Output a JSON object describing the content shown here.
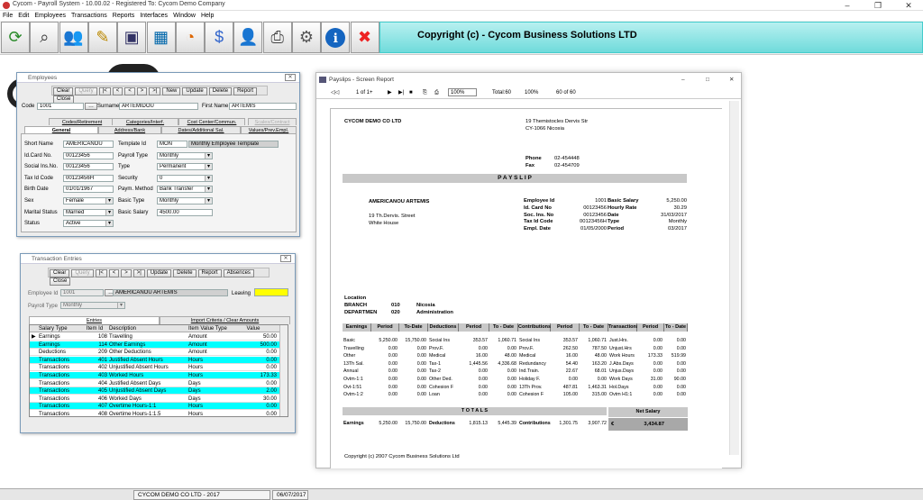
{
  "app": {
    "title": "Cycom - Payroll System - 10.00.02 - Registered To: Cycom Demo Company",
    "menu": [
      "File",
      "Edit",
      "Employees",
      "Transactions",
      "Reports",
      "Interfaces",
      "Window",
      "Help"
    ],
    "copyright": "Copyright (c) - Cycom Business Solutions LTD",
    "status": {
      "company": "CYCOM DEMO CO LTD - 2017",
      "date": "06/07/2017"
    }
  },
  "toolbar": [
    {
      "name": "refresh-icon",
      "glyph": "⟳",
      "color": "#2a8a2a"
    },
    {
      "name": "binoculars-icon",
      "glyph": "⌕",
      "color": "#333"
    },
    {
      "name": "employees-icon",
      "glyph": "👥",
      "color": "#4a7"
    },
    {
      "name": "edit-icon",
      "glyph": "✎",
      "color": "#b80"
    },
    {
      "name": "monitor-icon",
      "glyph": "▣",
      "color": "#336"
    },
    {
      "name": "spreadsheet-icon",
      "glyph": "▦",
      "color": "#06a"
    },
    {
      "name": "pie-chart-icon",
      "glyph": "◔",
      "color": "#d60"
    },
    {
      "name": "dollar-icon",
      "glyph": "$",
      "color": "#36c"
    },
    {
      "name": "user-icon",
      "glyph": "👤",
      "color": "#36c"
    },
    {
      "name": "printer-icon",
      "glyph": "⎙",
      "color": "#444"
    },
    {
      "name": "tools-icon",
      "glyph": "⚙",
      "color": "#555"
    },
    {
      "name": "info-icon",
      "glyph": "ℹ",
      "color": "#fff"
    },
    {
      "name": "close-icon",
      "glyph": "✖",
      "color": "#e22"
    }
  ],
  "employees": {
    "title": "Employees",
    "buttons": [
      "Clear",
      "Query",
      "|<",
      "<",
      "<",
      ">",
      ">|",
      "New",
      "Update",
      "Delete",
      "Report",
      "Close"
    ],
    "code_label": "Code",
    "code": "1001",
    "surname_label": "Surname",
    "surname": "ARTEMIDOU",
    "first_label": "First Name",
    "first": "ARTEMIS",
    "tabs_back": [
      "Codes/Retirement",
      "Categories/Interf.",
      "Cost Center/Commun.",
      "Scales/Contract"
    ],
    "tabs_front": [
      "General",
      "Address/Bank",
      "Dates/Additional Sal.",
      "Values/Prev.Empl."
    ],
    "left": [
      {
        "l": "Short Name",
        "v": "AMERICANOU"
      },
      {
        "l": "Id.Card No.",
        "v": "00123456"
      },
      {
        "l": "Social Ins.No.",
        "v": "00123456"
      },
      {
        "l": "Tax Id Code",
        "v": "00123456H"
      },
      {
        "l": "Birth Date",
        "v": "01/01/1967"
      },
      {
        "l": "Sex",
        "v": "Female"
      },
      {
        "l": "Marital Status",
        "v": "Married"
      },
      {
        "l": "Status",
        "v": "Active"
      }
    ],
    "right": [
      {
        "l": "Template Id",
        "v": "MON",
        "x": "Monthly Employee Template"
      },
      {
        "l": "Payroll Type",
        "v": "Monthly"
      },
      {
        "l": "Type",
        "v": "Permanent"
      },
      {
        "l": "Security",
        "v": "0"
      },
      {
        "l": "Paym. Method",
        "v": "Bank Transfer"
      },
      {
        "l": "Basic Type",
        "v": "Monthly"
      },
      {
        "l": "Basic Salary",
        "v": "4500.00"
      }
    ]
  },
  "trans": {
    "title": "Transaction Entries",
    "buttons": [
      "Clear",
      "Query",
      "|<",
      "<",
      ">",
      ">|",
      "Update",
      "Delete",
      "Report",
      "Absences",
      "Close"
    ],
    "emp_label": "Employee Id",
    "emp_id": "1001",
    "emp_name": "AMERICANOU ARTEMIS",
    "leaving_label": "Leaving",
    "ptype_label": "Payroll Type",
    "ptype": "Monthly",
    "tabs": [
      "Entries",
      "Import Criteria / Clear Amounts"
    ],
    "cols": [
      "Salary Type",
      "Item Id",
      "Description",
      "Item Value Type",
      "Value"
    ],
    "rows": [
      [
        "Earnings",
        "108",
        "Travelling",
        "Amount",
        "50.00",
        0
      ],
      [
        "Earnings",
        "114",
        "Other Earnings",
        "Amount",
        "500.00",
        1
      ],
      [
        "Deductions",
        "209",
        "Other Deductions",
        "Amount",
        "0.00",
        0
      ],
      [
        "Transactions",
        "401",
        "Justified Absent Hours",
        "Hours",
        "0.00",
        1
      ],
      [
        "Transactions",
        "402",
        "Unjustified Absent Hours",
        "Hours",
        "0.00",
        0
      ],
      [
        "Transactions",
        "403",
        "Worked Hours",
        "Hours",
        "173.33",
        1
      ],
      [
        "Transactions",
        "404",
        "Justified Absent Days",
        "Days",
        "0.00",
        0
      ],
      [
        "Transactions",
        "405",
        "Unjustified Absent Days",
        "Days",
        "2.00",
        1
      ],
      [
        "Transactions",
        "406",
        "Worked Days",
        "Days",
        "30.00",
        0
      ],
      [
        "Transactions",
        "407",
        "Overtime Hours-1:1",
        "Hours",
        "0.00",
        1
      ],
      [
        "Transactions",
        "408",
        "Overtime Hours-1:1.5",
        "Hours",
        "0.00",
        0
      ]
    ]
  },
  "report": {
    "title": "Payslips - Screen Report",
    "page": "1 of 1+",
    "zoom": "100%",
    "total": "Total:60",
    "pct": "100%",
    "of": "60 of 60",
    "company": "CYCOM DEMO CO LTD",
    "addr1": "19 Themistocles Dervis Str",
    "addr2": "CY-1066 Nicosia",
    "phone_l": "Phone",
    "phone": "02-454448",
    "fax_l": "Fax",
    "fax": "02-454709",
    "banner": "P A Y S L I P",
    "emp_name": "AMERICANOU ARTEMIS",
    "emp_a1": "19 Th.Dervis. Street",
    "emp_a2": "White House",
    "info1": [
      [
        "Employee Id",
        "1001"
      ],
      [
        "Id. Card No",
        "00123456"
      ],
      [
        "Soc. Ins. No",
        "00123456"
      ],
      [
        "Tax Id Code",
        "00123456H"
      ],
      [
        "Empl. Date",
        "01/05/2000"
      ]
    ],
    "info2": [
      [
        "Basic Salary",
        "5,250.00"
      ],
      [
        "Hourly Rate",
        "30.29"
      ],
      [
        "Date",
        "31/03/2017"
      ],
      [
        "Type",
        "Monthly"
      ],
      [
        "Period",
        "03/2017"
      ]
    ],
    "loc": "Location",
    "branch_l": "BRANCH",
    "branch_c": "010",
    "branch_n": "Nicosia",
    "dept_l": "DEPARTMEN",
    "dept_c": "020",
    "dept_n": "Administration",
    "heads": [
      "Earnings",
      "Period",
      "To-Date",
      "Deductions",
      "Period",
      "To - Date",
      "Contributions",
      "Period",
      "To - Date",
      "Transactions",
      "Period",
      "To - Date"
    ],
    "earn": [
      [
        "Basic",
        "5,250.00",
        "15,750.00"
      ],
      [
        "Travelling",
        "0.00",
        "0.00"
      ],
      [
        "Other",
        "0.00",
        "0.00"
      ],
      [
        "13Th Sal.",
        "0.00",
        "0.00"
      ],
      [
        "Annual",
        "0.00",
        "0.00"
      ],
      [
        "Ovtm-1:1",
        "0.00",
        "0.00"
      ],
      [
        "Ovt-1:51",
        "0.00",
        "0.00"
      ],
      [
        "Ovtm-1:2",
        "0.00",
        "0.00"
      ]
    ],
    "ded": [
      [
        "Social Ins",
        "353.57",
        "1,060.71"
      ],
      [
        "Prov.F.",
        "0.00",
        "0.00"
      ],
      [
        "Medical",
        "16.00",
        "48.00"
      ],
      [
        "Tax-1",
        "1,445.56",
        "4,336.68"
      ],
      [
        "Tax-2",
        "0.00",
        "0.00"
      ],
      [
        "Other Ded.",
        "0.00",
        "0.00"
      ],
      [
        "Cohesion F",
        "0.00",
        "0.00"
      ],
      [
        "Loan",
        "0.00",
        "0.00"
      ]
    ],
    "con": [
      [
        "Social Ins",
        "353.57",
        "1,060.71"
      ],
      [
        "Prov.F.",
        "262.50",
        "787.50"
      ],
      [
        "Medical",
        "16.00",
        "48.00"
      ],
      [
        "Redundancy",
        "54.40",
        "163.20"
      ],
      [
        "Ind.Train.",
        "22.67",
        "68.01"
      ],
      [
        "Holiday F.",
        "0.00",
        "0.00"
      ],
      [
        "13Th Prov.",
        "487.81",
        "1,463.31"
      ],
      [
        "Cohesion F",
        "105.00",
        "315.00"
      ]
    ],
    "trn": [
      [
        "Just.Hrs.",
        "0.00",
        "0.00"
      ],
      [
        "Unjust.Hrs",
        "0.00",
        "0.00"
      ],
      [
        "Work Hours",
        "173.33",
        "519.99"
      ],
      [
        "J.Abs.Days",
        "0.00",
        "0.00"
      ],
      [
        "Unjus.Days",
        "0.00",
        "0.00"
      ],
      [
        "Work Days",
        "31.00",
        "90.00"
      ],
      [
        "Hol.Days",
        "0.00",
        "0.00"
      ],
      [
        "Ovtm H1:1",
        "0.00",
        "0.00"
      ]
    ],
    "totals": "T O T A L S",
    "net_l": "Net Salary",
    "cur": "€",
    "net": "3,434.87",
    "tot": [
      [
        "Earnings",
        "5,250.00",
        "15,750.00"
      ],
      [
        "Deductions",
        "1,815.13",
        "5,445.39"
      ],
      [
        "Contributions",
        "1,301.75",
        "3,907.72"
      ]
    ],
    "footer": "Copyright (c) 2007 Cycom Business Solutions Ltd"
  }
}
